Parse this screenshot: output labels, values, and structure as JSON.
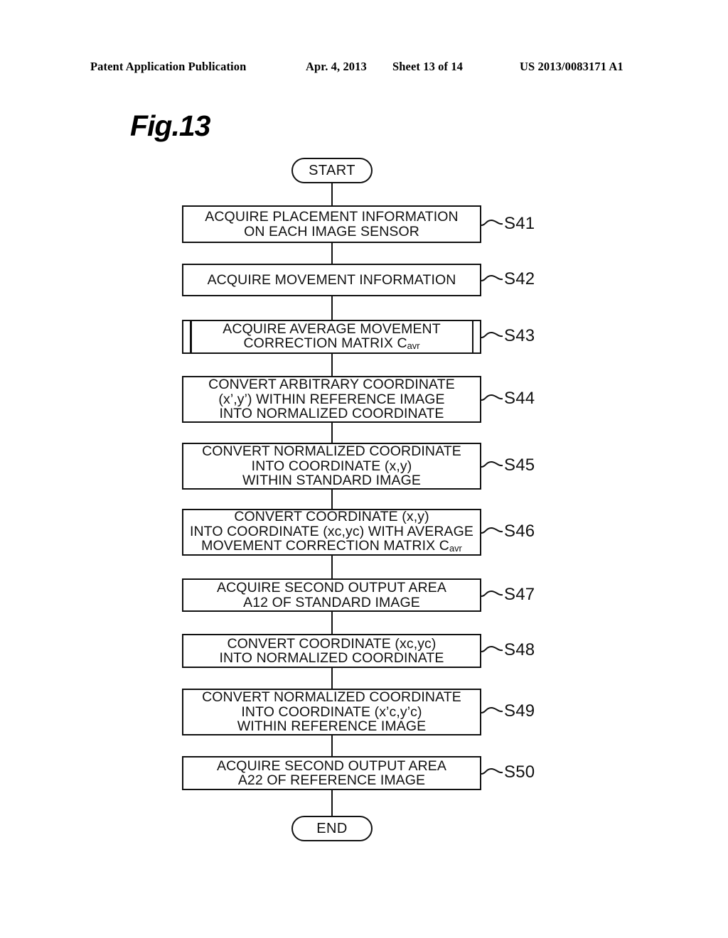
{
  "header": {
    "publication": "Patent Application Publication",
    "date": "Apr. 4, 2013",
    "sheet": "Sheet 13 of 14",
    "patent_number": "US 2013/0083171 A1"
  },
  "figure": {
    "label": "Fig.13"
  },
  "flowchart": {
    "start_label": "START",
    "end_label": "END",
    "steps": [
      {
        "ref": "S41",
        "type": "process",
        "lines": [
          "ACQUIRE PLACEMENT INFORMATION",
          "ON EACH IMAGE SENSOR"
        ]
      },
      {
        "ref": "S42",
        "type": "process",
        "lines": [
          "ACQUIRE MOVEMENT INFORMATION"
        ]
      },
      {
        "ref": "S43",
        "type": "subprocess",
        "lines": [
          "ACQUIRE AVERAGE MOVEMENT",
          "CORRECTION MATRIX C|avr"
        ]
      },
      {
        "ref": "S44",
        "type": "process",
        "lines": [
          "CONVERT ARBITRARY COORDINATE",
          "(x’,y’) WITHIN REFERENCE IMAGE",
          "INTO NORMALIZED COORDINATE"
        ]
      },
      {
        "ref": "S45",
        "type": "process",
        "lines": [
          "CONVERT NORMALIZED COORDINATE",
          "INTO COORDINATE (x,y)",
          "WITHIN STANDARD IMAGE"
        ]
      },
      {
        "ref": "S46",
        "type": "process",
        "lines": [
          "CONVERT COORDINATE (x,y)",
          "INTO COORDINATE (xc,yc) WITH AVERAGE",
          "MOVEMENT CORRECTION MATRIX C|avr"
        ]
      },
      {
        "ref": "S47",
        "type": "process",
        "lines": [
          "ACQUIRE SECOND OUTPUT AREA",
          "A12 OF STANDARD IMAGE"
        ]
      },
      {
        "ref": "S48",
        "type": "process",
        "lines": [
          "CONVERT COORDINATE (xc,yc)",
          "INTO NORMALIZED COORDINATE"
        ]
      },
      {
        "ref": "S49",
        "type": "process",
        "lines": [
          "CONVERT NORMALIZED COORDINATE",
          "INTO COORDINATE (x’c,y’c)",
          "WITHIN REFERENCE IMAGE"
        ]
      },
      {
        "ref": "S50",
        "type": "process",
        "lines": [
          "ACQUIRE SECOND OUTPUT AREA",
          "A22 OF REFERENCE IMAGE"
        ]
      }
    ]
  },
  "colors": {
    "ink": "#111111",
    "paper": "#ffffff"
  }
}
